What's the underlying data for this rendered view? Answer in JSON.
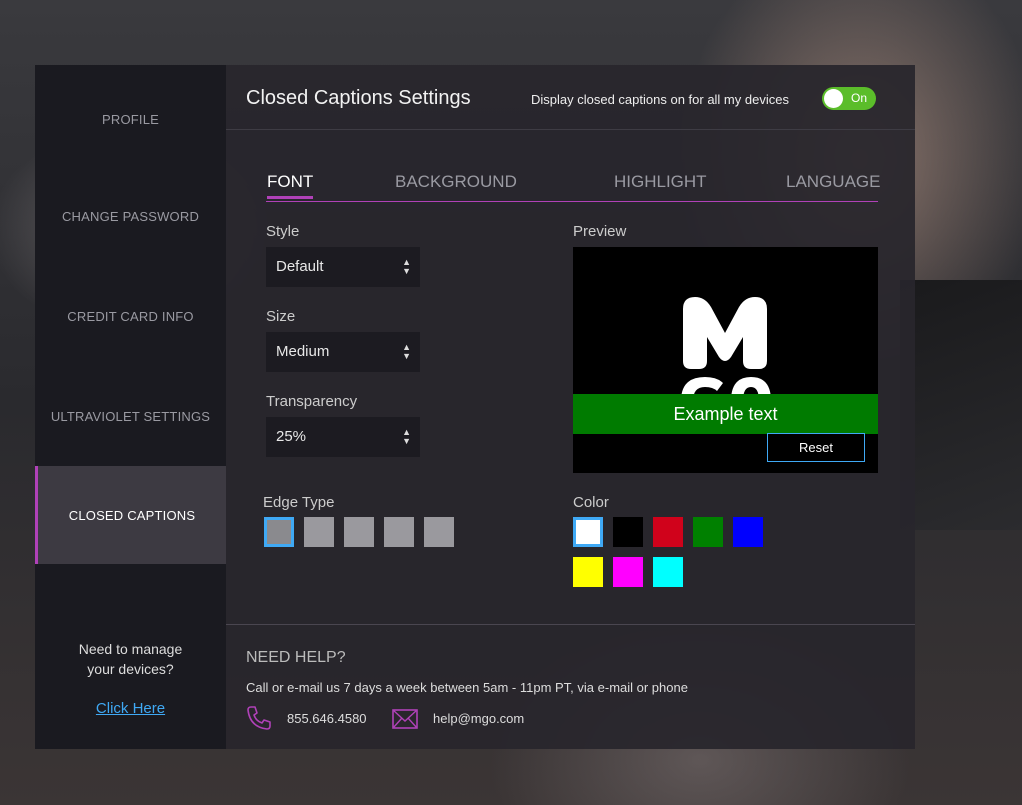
{
  "sidebar": {
    "items": [
      {
        "label": "PROFILE"
      },
      {
        "label": "CHANGE PASSWORD"
      },
      {
        "label": "CREDIT CARD INFO"
      },
      {
        "label": "ULTRAVIOLET SETTINGS"
      },
      {
        "label": "CLOSED CAPTIONS"
      }
    ],
    "help_line1": "Need to manage",
    "help_line2": "your devices?",
    "help_link": "Click Here"
  },
  "header": {
    "title": "Closed Captions Settings",
    "toggle_label": "Display closed captions on for all my devices",
    "toggle_state": "On"
  },
  "tabs": [
    {
      "label": "FONT"
    },
    {
      "label": "BACKGROUND"
    },
    {
      "label": "HIGHLIGHT"
    },
    {
      "label": "LANGUAGE"
    }
  ],
  "font": {
    "style_label": "Style",
    "style_value": "Default",
    "size_label": "Size",
    "size_value": "Medium",
    "transparency_label": "Transparency",
    "transparency_value": "25%",
    "edge_type_label": "Edge Type",
    "edge_swatches": [
      {
        "color": "#8a8a8e"
      },
      {
        "color": "#9a999e"
      },
      {
        "color": "#9a999e"
      },
      {
        "color": "#9a999e"
      },
      {
        "color": "#9a999e"
      }
    ],
    "color_label": "Color",
    "colors": [
      {
        "color": "#ffffff"
      },
      {
        "color": "#000000"
      },
      {
        "color": "#d0021b"
      },
      {
        "color": "#008000"
      },
      {
        "color": "#0000ff"
      },
      {
        "color": "#ffff00"
      },
      {
        "color": "#ff00ff"
      },
      {
        "color": "#00ffff"
      }
    ]
  },
  "preview": {
    "label": "Preview",
    "example_text": "Example text",
    "reset_label": "Reset"
  },
  "footer": {
    "heading": "NEED HELP?",
    "text": "Call or e-mail us 7 days a week between 5am - 11pm PT, via e-mail or phone",
    "phone": "855.646.4580",
    "email": "help@mgo.com"
  },
  "accent_color": "#b041b8",
  "toggle_color": "#5bbd2a"
}
